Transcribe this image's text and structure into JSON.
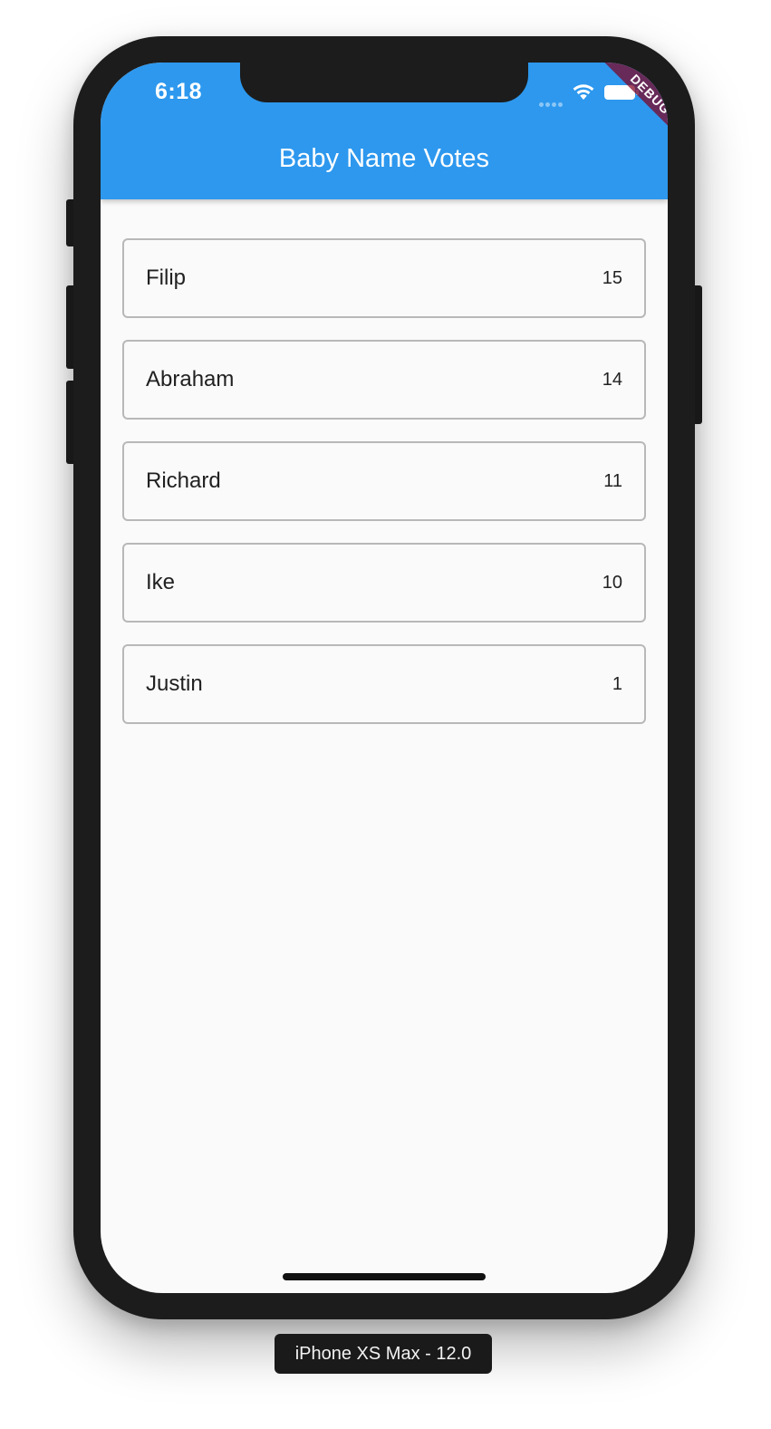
{
  "status_bar": {
    "time": "6:18"
  },
  "debug_banner": "DEBUG",
  "appbar": {
    "title": "Baby Name Votes",
    "color": "#2d98ee"
  },
  "votes": [
    {
      "name": "Filip",
      "votes": "15"
    },
    {
      "name": "Abraham",
      "votes": "14"
    },
    {
      "name": "Richard",
      "votes": "11"
    },
    {
      "name": "Ike",
      "votes": "10"
    },
    {
      "name": "Justin",
      "votes": "1"
    }
  ],
  "device_label": "iPhone XS Max - 12.0"
}
